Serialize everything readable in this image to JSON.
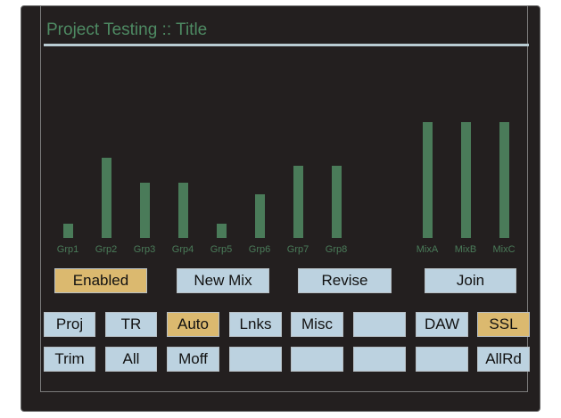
{
  "title": "Project Testing  ::  Title",
  "colors": {
    "bar": "#4a7b59",
    "button": "#bcd2e0",
    "active": "#dbb96f",
    "title": "#4e8a63"
  },
  "meters": [
    {
      "label": "Grp1",
      "level": 0.12
    },
    {
      "label": "Grp2",
      "level": 0.69
    },
    {
      "label": "Grp3",
      "level": 0.48
    },
    {
      "label": "Grp4",
      "level": 0.48
    },
    {
      "label": "Grp5",
      "level": 0.12
    },
    {
      "label": "Grp6",
      "level": 0.38
    },
    {
      "label": "Grp7",
      "level": 0.62
    },
    {
      "label": "Grp8",
      "level": 0.62
    },
    {
      "label": "MixA",
      "level": 1.0
    },
    {
      "label": "MixB",
      "level": 1.0
    },
    {
      "label": "MixC",
      "level": 1.0
    }
  ],
  "mode_buttons": [
    {
      "label": "Enabled",
      "active": true
    },
    {
      "label": "New Mix",
      "active": false
    },
    {
      "label": "Revise",
      "active": false
    },
    {
      "label": "Join",
      "active": false
    }
  ],
  "row1": [
    {
      "label": "Proj",
      "active": false
    },
    {
      "label": "TR",
      "active": false
    },
    {
      "label": "Auto",
      "active": true
    },
    {
      "label": "Lnks",
      "active": false
    },
    {
      "label": "Misc",
      "active": false
    },
    {
      "label": "",
      "active": false
    },
    {
      "label": "DAW",
      "active": false
    },
    {
      "label": "SSL",
      "active": true
    }
  ],
  "row2": [
    {
      "label": "Trim",
      "active": false
    },
    {
      "label": "All",
      "active": false
    },
    {
      "label": "Moff",
      "active": false
    },
    {
      "label": "",
      "active": false
    },
    {
      "label": "",
      "active": false
    },
    {
      "label": "",
      "active": false
    },
    {
      "label": "",
      "active": false
    },
    {
      "label": "AllRd",
      "active": false
    }
  ]
}
